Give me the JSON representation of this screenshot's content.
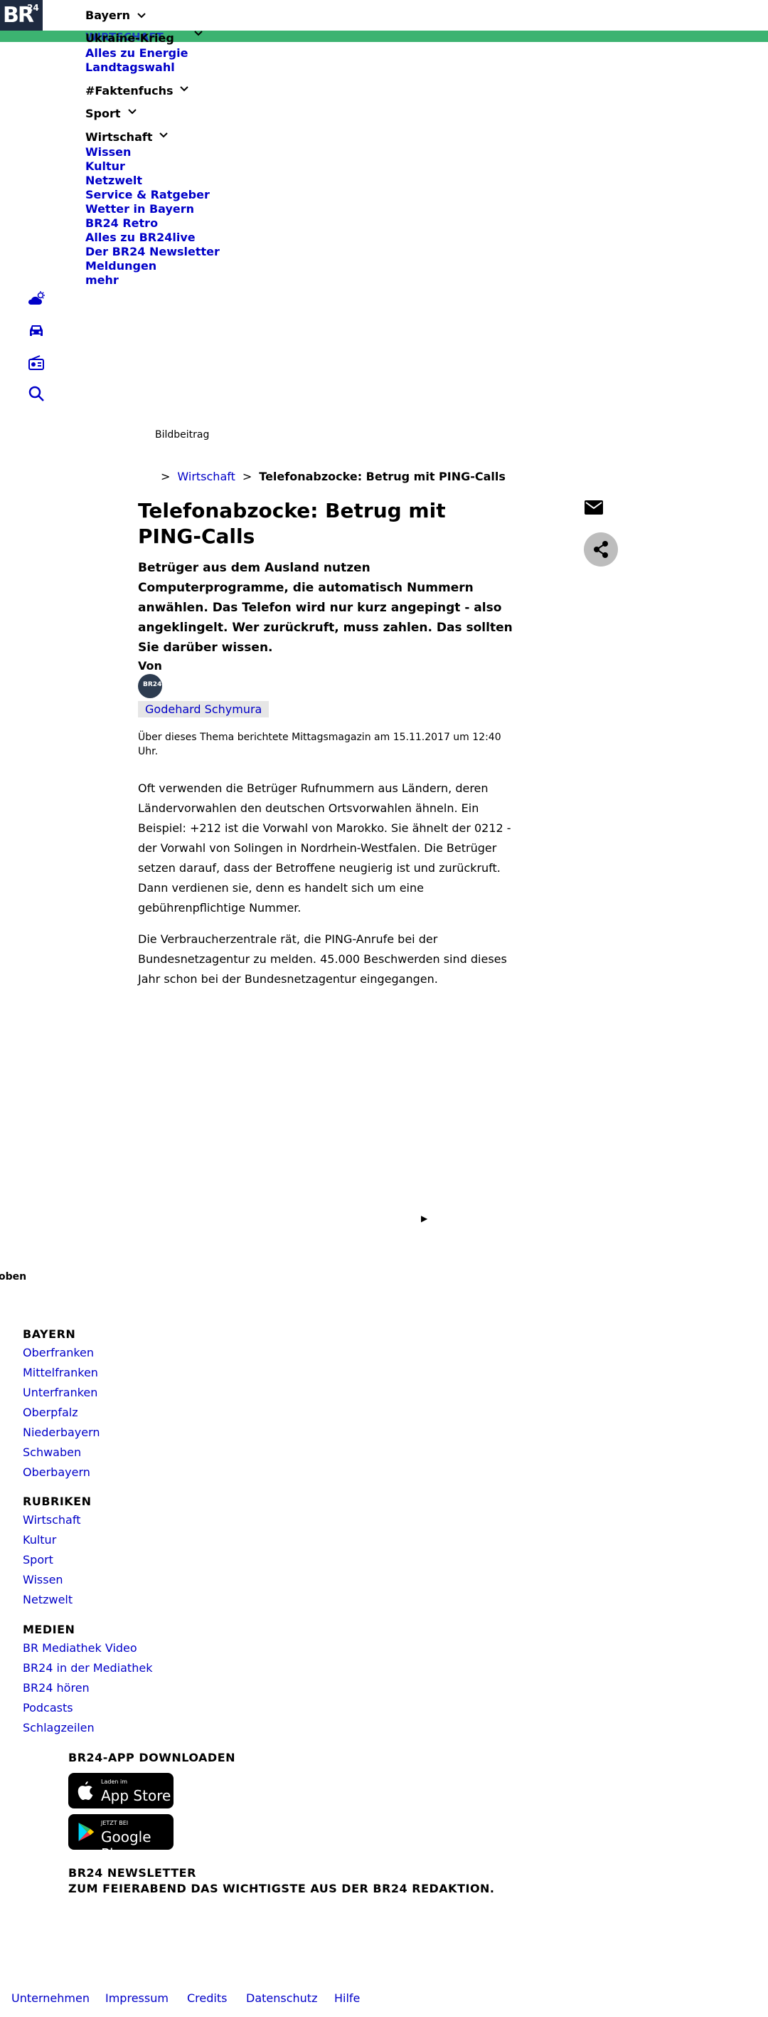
{
  "brand": {
    "logo": "BR",
    "logo_sup": "24",
    "accent": "#3cb371",
    "link_color": "#0000c8"
  },
  "nav": {
    "bayern": "Bayern",
    "wirtschaft_overlay": "WIRTSCHAFT",
    "ukraine": "Ukraine-Krieg",
    "energie": "Alles zu Energie",
    "landtagswahl": "Landtagswahl",
    "faktenfuchs": "#Faktenfuchs",
    "sport": "Sport",
    "wirtschaft": "Wirtschaft",
    "links": [
      "Wissen",
      "Kultur",
      "Netzwelt",
      "Service & Ratgeber",
      "Wetter in Bayern",
      "BR24 Retro",
      "Alles zu BR24live",
      "Der BR24 Newsletter",
      "Meldungen",
      "mehr"
    ]
  },
  "side_icons": [
    "weather-icon",
    "car-icon",
    "radio-icon",
    "search-icon"
  ],
  "article": {
    "kind": "Bildbeitrag",
    "breadcrumb": {
      "section": "Wirtschaft",
      "current": "Telefonabzocke: Betrug mit PING-Calls"
    },
    "title": "Telefonabzocke: Betrug mit PING-Calls",
    "teaser": "Betrüger aus dem Ausland nutzen Computerprogramme, die automatisch Nummern anwählen. Das Telefon wird nur kurz angepingt - also angeklingelt. Wer zurückruft, muss zahlen. Das sollten Sie darüber wissen.",
    "von": "Von",
    "avatar_text": "BR24",
    "author": "Godehard Schymura",
    "aired": "Über dieses Thema berichtete Mittagsmagazin am 15.11.2017 um 12:40 Uhr.",
    "paragraphs": [
      "Oft verwenden die Betrüger Rufnummern aus Ländern, deren Ländervorwahlen den deutschen Ortsvorwahlen ähneln. Ein Beispiel: +212 ist die Vorwahl von Marokko. Sie ähnelt der 0212 - der Vorwahl von Solingen in Nordrhein-Westfalen. Die Betrüger setzen darauf, dass der Betroffene neugierig ist und zurückruft. Dann verdienen sie, denn es handelt sich um eine gebührenpflichtige Nummer.",
      "Die Verbraucherzentrale rät, die PING-Anrufe bei der Bundesnetzagentur zu melden. 45.000 Beschwerden sind dieses Jahr schon bei der Bundesnetzagentur eingegangen."
    ]
  },
  "play_glyph": "▶",
  "back_to_top": "oben",
  "footer": {
    "bayern": {
      "title": "BAYERN",
      "links": [
        "Oberfranken",
        "Mittelfranken",
        "Unterfranken",
        "Oberpfalz",
        "Niederbayern",
        "Schwaben",
        "Oberbayern"
      ]
    },
    "rubriken": {
      "title": "RUBRIKEN",
      "links": [
        "Wirtschaft",
        "Kultur",
        "Sport",
        "Wissen",
        "Netzwelt"
      ]
    },
    "medien": {
      "title": "MEDIEN",
      "links": [
        "BR Mediathek Video",
        "BR24 in der Mediathek",
        "BR24 hören",
        "Podcasts",
        "Schlagzeilen"
      ]
    },
    "app_title": "BR24-APP DOWNLOADEN",
    "appstore_small": "Laden im",
    "appstore_big": "App Store",
    "googleplay_small": "JETZT BEI",
    "googleplay_big": "Google Play",
    "newsletter_title": "BR24 NEWSLETTER",
    "newsletter_sub": "ZUM FEIERABEND DAS WICHTIGSTE AUS DER BR24 REDAKTION.",
    "bottom_links": [
      "Unternehmen",
      "Impressum",
      "Credits",
      "Datenschutz",
      "Hilfe"
    ]
  }
}
